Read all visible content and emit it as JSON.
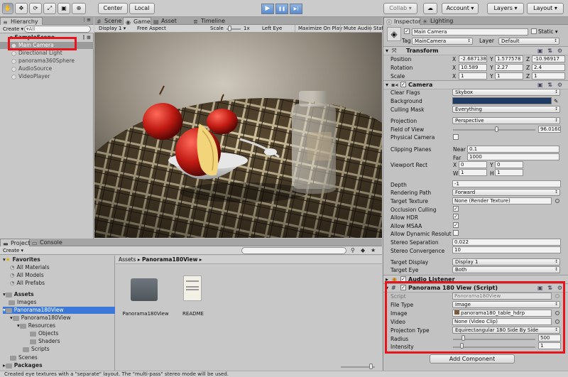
{
  "toolbar": {
    "tools": [
      "hand-icon",
      "move-icon",
      "rotate-icon",
      "scale-icon",
      "rect-icon",
      "transform-icon"
    ],
    "pivot": "Center",
    "space": "Local",
    "play_icon": "▶",
    "pause_icon": "❚❚",
    "step_icon": "▶|",
    "collab": "Collab ▾",
    "account": "Account",
    "layers": "Layers",
    "layout": "Layout"
  },
  "hierarchy": {
    "tab": "Hierarchy",
    "create": "Create ▾",
    "search_placeholder": "▾All",
    "scene": "SampleScene",
    "items": [
      "Main Camera",
      "Directional Light",
      "panorama360Sphere",
      "AudioSource",
      "VideoPlayer"
    ]
  },
  "game_view": {
    "tabs": [
      "Scene",
      "Game",
      "Asset Store",
      "Timeline"
    ],
    "display": "Display 1",
    "aspect": "Free Aspect",
    "scale_label": "Scale",
    "scale_value": "1x",
    "eye": "Left Eye",
    "maximize": "Maximize On Play",
    "mute": "Mute Audio",
    "stats": "Stat"
  },
  "project": {
    "tabs": [
      "Project",
      "Console"
    ],
    "create": "Create ▾",
    "favorites": "Favorites",
    "favorite_items": [
      "All Materials",
      "All Models",
      "All Prefabs"
    ],
    "assets": "Assets",
    "tree": [
      {
        "label": "Images",
        "indent": 1,
        "selected": false
      },
      {
        "label": "Panorama180View",
        "indent": 1,
        "selected": true
      },
      {
        "label": "Panorama180View",
        "indent": 2,
        "selected": false
      },
      {
        "label": "Resources",
        "indent": 3,
        "selected": false
      },
      {
        "label": "Objects",
        "indent": 4,
        "selected": false
      },
      {
        "label": "Shaders",
        "indent": 4,
        "selected": false
      },
      {
        "label": "Scripts",
        "indent": 3,
        "selected": false
      },
      {
        "label": "Scenes",
        "indent": 1,
        "selected": false
      }
    ],
    "packages": "Packages",
    "breadcrumb_root": "Assets",
    "breadcrumb_sep": "▸",
    "breadcrumb_current": "Panorama180View",
    "files": [
      {
        "name": "Panorama180View",
        "kind": "folder"
      },
      {
        "name": "README",
        "kind": "document"
      }
    ]
  },
  "inspector": {
    "tabs": [
      "Inspector",
      "Lighting"
    ],
    "object_name": "Main Camera",
    "static_label": "Static ▾",
    "tag_label": "Tag",
    "tag_value": "MainCamera",
    "layer_label": "Layer",
    "layer_value": "Default",
    "transform": {
      "title": "Transform",
      "rows": [
        {
          "label": "Position",
          "x": "-2.687138",
          "y": "1.577578",
          "z": "-10.96917"
        },
        {
          "label": "Rotation",
          "x": "10.589",
          "y": "2.27",
          "z": "2.4"
        },
        {
          "label": "Scale",
          "x": "1",
          "y": "1",
          "z": "1"
        }
      ]
    },
    "camera": {
      "title": "Camera",
      "clear_flags_label": "Clear Flags",
      "clear_flags": "Skybox",
      "background_label": "Background",
      "background_color": "#1f3a63",
      "culling_label": "Culling Mask",
      "culling": "Everything",
      "projection_label": "Projection",
      "projection": "Perspective",
      "fov_label": "Field of View",
      "fov": "96.0160",
      "physical_label": "Physical Camera",
      "clipping_label": "Clipping Planes",
      "near_label": "Near",
      "near": "0.1",
      "far_label": "Far",
      "far": "1000",
      "viewport_label": "Viewport Rect",
      "vx": "0",
      "vy": "0",
      "vw": "1",
      "vh": "1",
      "depth_label": "Depth",
      "depth": "-1",
      "rendering_label": "Rendering Path",
      "rendering": "Forward",
      "target_label": "Target Texture",
      "target": "None (Render Texture)",
      "occlusion_label": "Occlusion Culling",
      "hdr_label": "Allow HDR",
      "msaa_label": "Allow MSAA",
      "dynres_label": "Allow Dynamic Resoluti",
      "stereo_sep_label": "Stereo Separation",
      "stereo_sep": "0.022",
      "stereo_conv_label": "Stereo Convergence",
      "stereo_conv": "10",
      "target_display_label": "Target Display",
      "target_display": "Display 1",
      "target_eye_label": "Target Eye",
      "target_eye": "Both"
    },
    "audio_listener": "Audio Listener",
    "panorama": {
      "title": "Panorama 180 View (Script)",
      "script_label": "Script",
      "script": "Panorama180View",
      "file_type_label": "File Type",
      "file_type": "Image",
      "image_label": "Image",
      "image": "panorama180_table_hdrp",
      "video_label": "Video",
      "video": "None (Video Clip)",
      "projection_label": "Projecton Type",
      "projection": "Equirectangular 180 Side By Side",
      "radius_label": "Radius",
      "radius": "500",
      "intensity_label": "Intensity",
      "intensity": "1"
    },
    "add_component": "Add Component"
  },
  "status": "Created eye textures with a \"separate\" layout.  The \"multi-pass\" stereo mode will be used."
}
